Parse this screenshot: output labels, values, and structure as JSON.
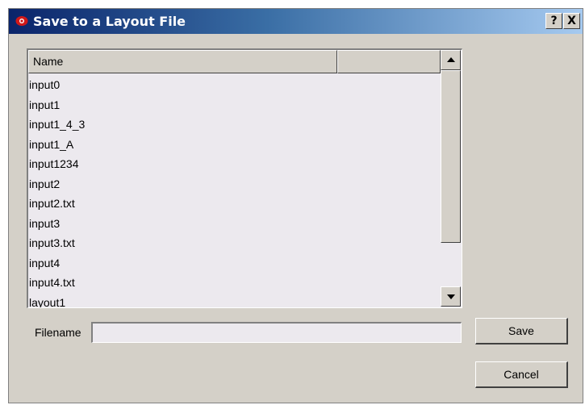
{
  "window": {
    "title": "Save to a Layout File",
    "help_label": "?",
    "close_label": "X"
  },
  "list": {
    "columns": [
      "Name",
      ""
    ],
    "rows": [
      "input0",
      "input1",
      "input1_4_3",
      "input1_A",
      "input1234",
      "input2",
      "input2.txt",
      "input3",
      "input3.txt",
      "input4",
      "input4.txt",
      "layout1"
    ]
  },
  "filename": {
    "label": "Filename",
    "value": ""
  },
  "buttons": {
    "save": "Save",
    "cancel": "Cancel"
  }
}
